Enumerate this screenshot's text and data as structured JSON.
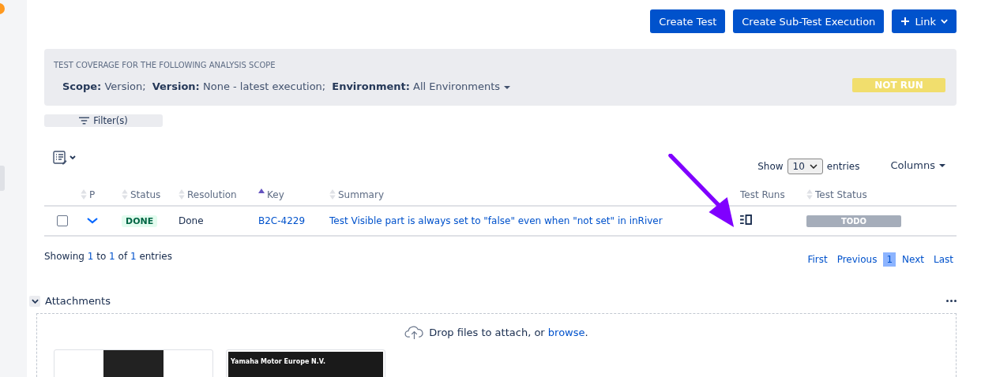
{
  "actions": [
    {
      "label": "Create Test",
      "kind": "plain"
    },
    {
      "label": "Create Sub-Test Execution",
      "kind": "plain"
    },
    {
      "label": "Link",
      "kind": "link-menu"
    }
  ],
  "coverage": {
    "heading": "TEST COVERAGE FOR THE FOLLOWING ANALYSIS SCOPE",
    "scope": [
      {
        "label": "Scope:",
        "value": "Version;"
      },
      {
        "label": "Version:",
        "value": "None - latest execution;"
      },
      {
        "label": "Environment:",
        "value": "All Environments",
        "dropdown": true
      }
    ],
    "status": "NOT RUN"
  },
  "filter_button": "Filter(s)",
  "page_size": {
    "before": "Show",
    "value": "10",
    "after": "entries"
  },
  "columns_menu": "Columns",
  "table": {
    "columns": [
      {
        "label": "P",
        "sortable": true,
        "sorted": false
      },
      {
        "label": "Status",
        "sortable": true,
        "sorted": false
      },
      {
        "label": "Resolution",
        "sortable": true,
        "sorted": false
      },
      {
        "label": "Key",
        "sortable": true,
        "sorted": true
      },
      {
        "label": "Summary",
        "sortable": true,
        "sorted": false
      },
      {
        "label": "Test Runs",
        "sortable": false,
        "sorted": false
      },
      {
        "label": "Test Status",
        "sortable": true,
        "sorted": false
      }
    ],
    "rows": [
      {
        "checked": false,
        "status": "DONE",
        "resolution": "Done",
        "key": "B2C-4229",
        "summary": "Test Visible part is always set to \"false\" even when \"not set\" in inRiver",
        "test_status": "TODO"
      }
    ]
  },
  "info": {
    "parts": [
      "Showing ",
      "1",
      " to ",
      "1",
      " of ",
      "1",
      " entries"
    ]
  },
  "pagination": [
    {
      "label": "First",
      "selected": false
    },
    {
      "label": "Previous",
      "selected": false
    },
    {
      "label": "1",
      "selected": true
    },
    {
      "label": "Next",
      "selected": false
    },
    {
      "label": "Last",
      "selected": false
    }
  ],
  "attachments": {
    "title": "Attachments",
    "expanded": true,
    "drop_text": "Drop files to attach, or ",
    "browse": "browse",
    "drop_end": ".",
    "thumbnails": [
      {
        "kind": "code"
      },
      {
        "kind": "window",
        "title": "Yamaha Motor Europe N.V."
      }
    ]
  }
}
